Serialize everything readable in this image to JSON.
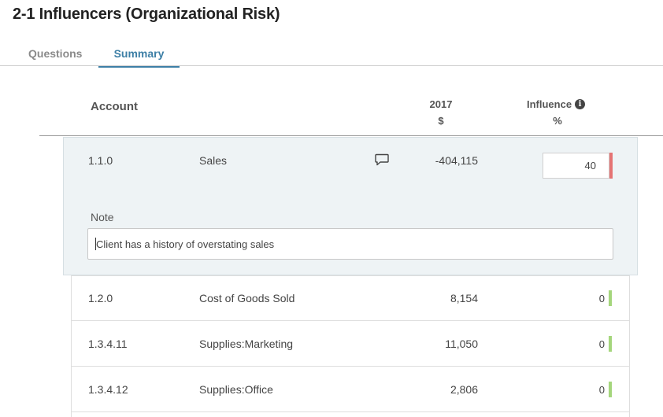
{
  "page": {
    "title": "2-1 Influencers (Organizational Risk)"
  },
  "tabs": [
    {
      "label": "Questions",
      "active": false
    },
    {
      "label": "Summary",
      "active": true
    }
  ],
  "columns": {
    "account": "Account",
    "year": "2017",
    "currency": "$",
    "influence": "Influence",
    "influence_unit": "%"
  },
  "rows": [
    {
      "code": "1.1.0",
      "name": "Sales",
      "amount": "-404,115",
      "influence": "40",
      "indicator": "red",
      "has_comment": true,
      "note_label": "Note",
      "note": "Client has a history of overstating sales"
    },
    {
      "code": "1.2.0",
      "name": "Cost of Goods Sold",
      "amount": "8,154",
      "influence": "0",
      "indicator": "green"
    },
    {
      "code": "1.3.4.11",
      "name": "Supplies:Marketing",
      "amount": "11,050",
      "influence": "0",
      "indicator": "green"
    },
    {
      "code": "1.3.4.12",
      "name": "Supplies:Office",
      "amount": "2,806",
      "influence": "0",
      "indicator": "green"
    }
  ],
  "colors": {
    "accent": "#3d7fa6",
    "red_indicator": "#e57373",
    "green_indicator": "#a5d67c"
  },
  "icons": {
    "comment": "speech-bubble-icon",
    "info": "info-circle-icon"
  }
}
